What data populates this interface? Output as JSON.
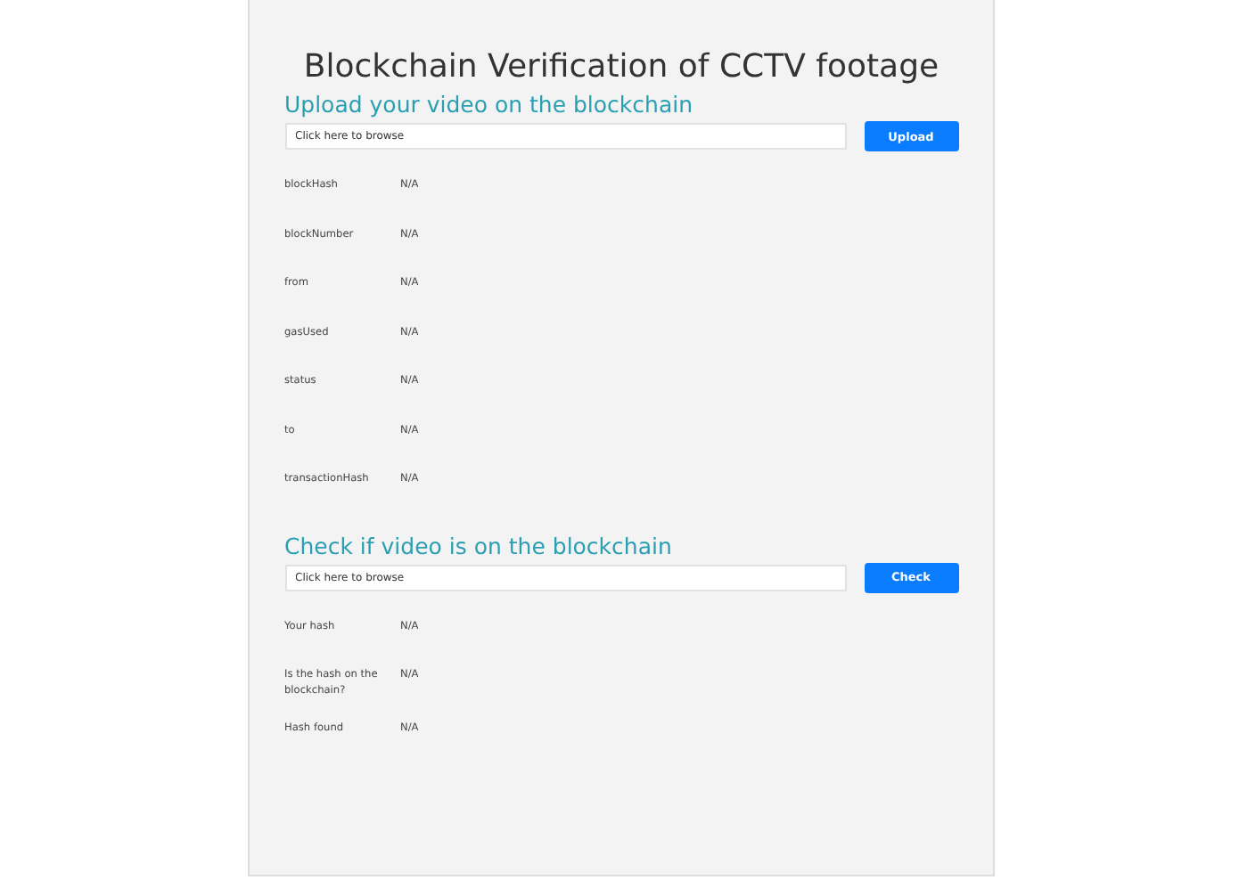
{
  "title": "Blockchain Verification of CCTV footage",
  "sections": [
    {
      "heading": "Upload your video on the blockchain",
      "field": {
        "placeholder": "Click here to browse"
      },
      "button": "Upload",
      "rows": [
        {
          "label": "blockHash",
          "value": "N/A"
        },
        {
          "label": "blockNumber",
          "value": "N/A"
        },
        {
          "label": "from",
          "value": "N/A"
        },
        {
          "label": "gasUsed",
          "value": "N/A"
        },
        {
          "label": "status",
          "value": "N/A"
        },
        {
          "label": "to",
          "value": "N/A"
        },
        {
          "label": "transactionHash",
          "value": "N/A"
        }
      ]
    },
    {
      "heading": "Check if video is on the blockchain",
      "field": {
        "placeholder": "Click here to browse"
      },
      "button": "Check",
      "rows": [
        {
          "label": "Your hash",
          "value": "N/A"
        },
        {
          "label": "Is the hash on the blockchain?",
          "value": "N/A"
        },
        {
          "label": "Hash found",
          "value": "N/A"
        }
      ]
    }
  ]
}
